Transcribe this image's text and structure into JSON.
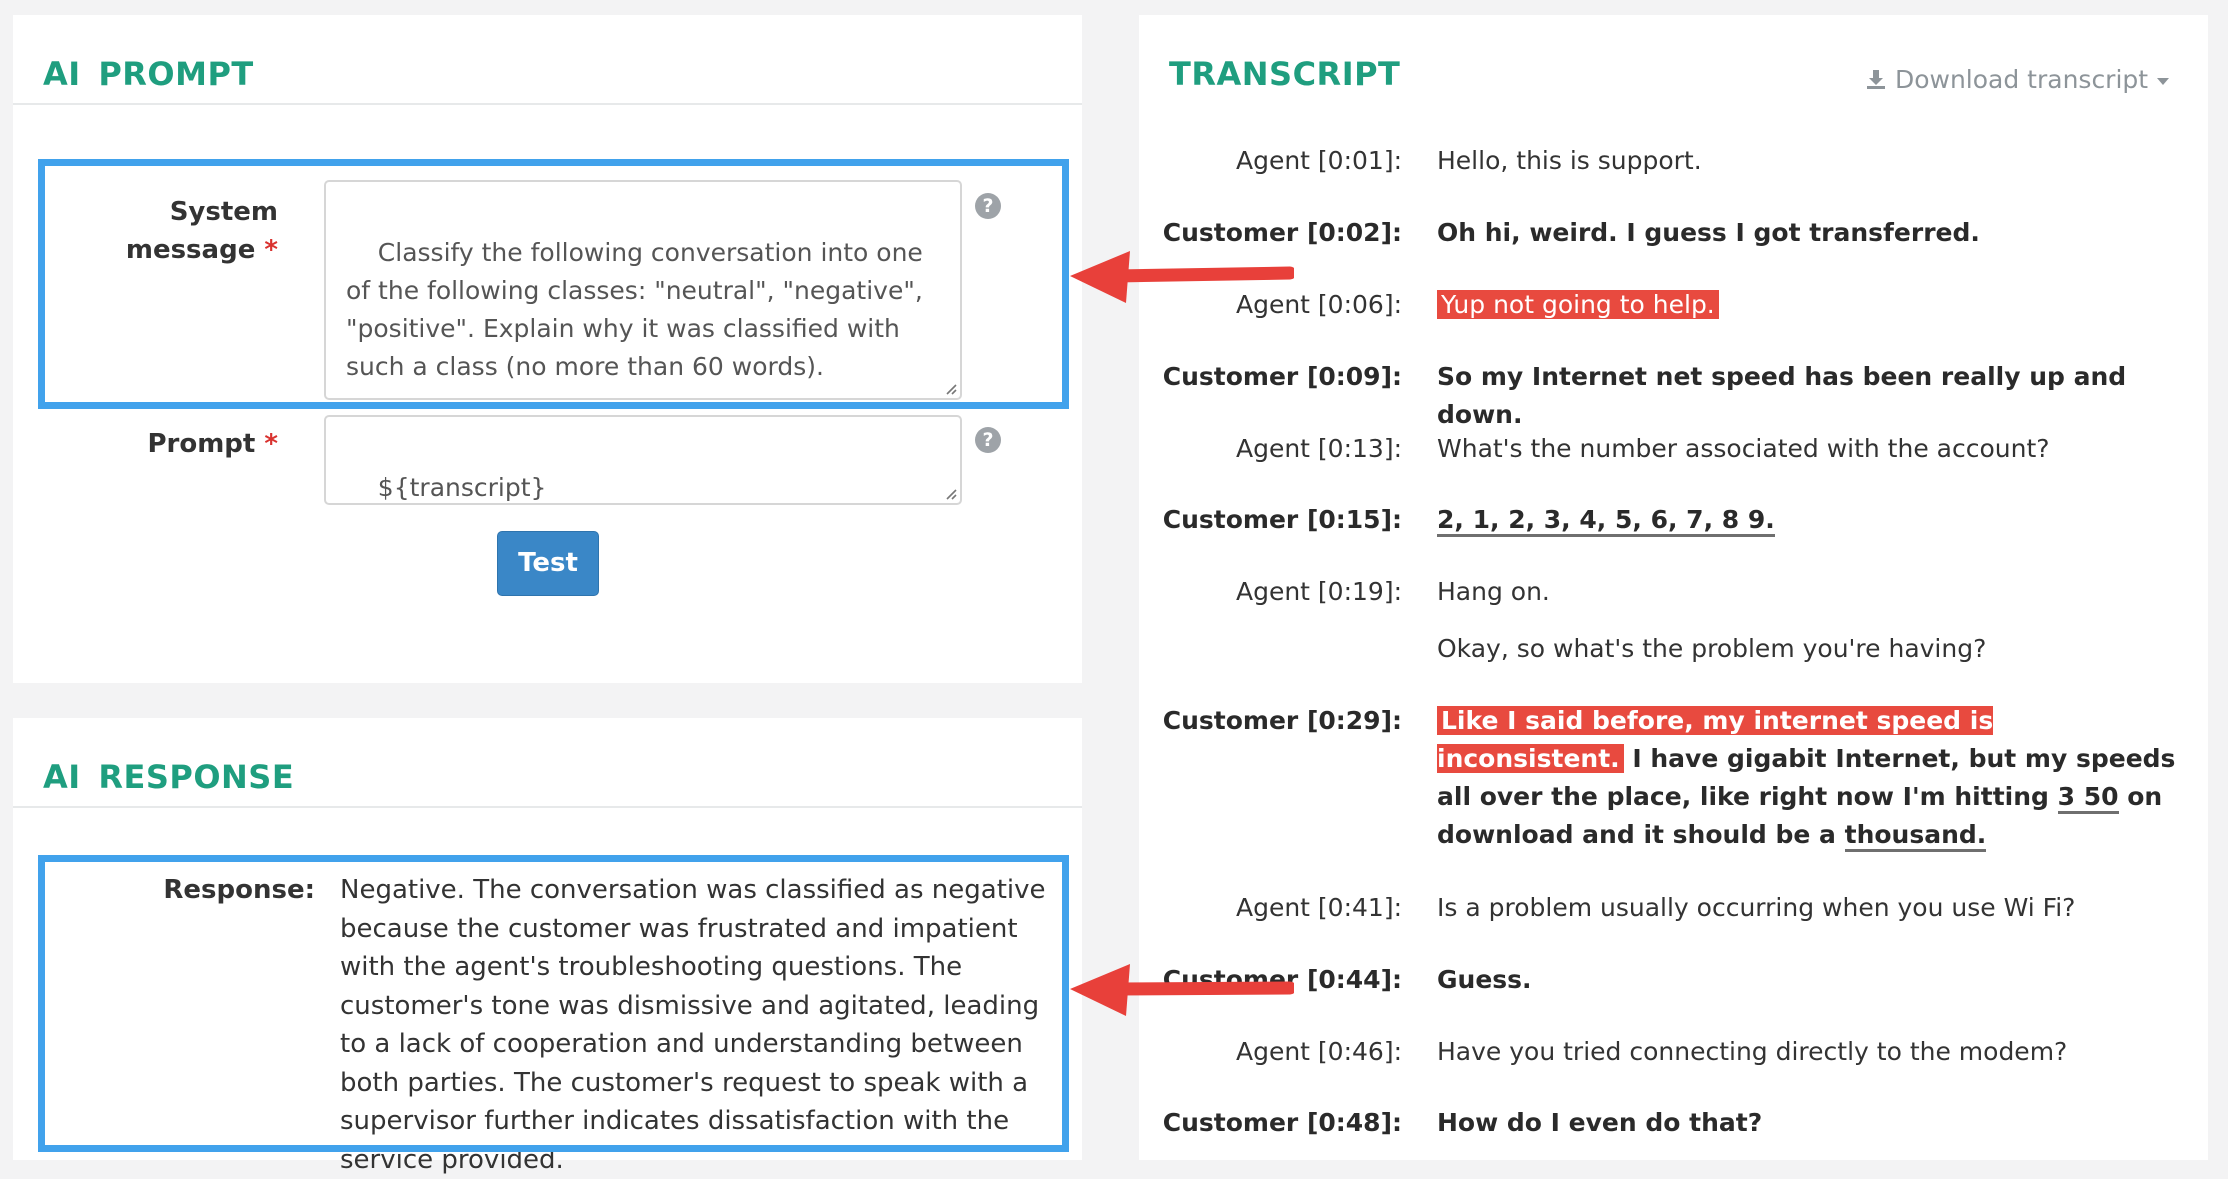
{
  "prompt_panel": {
    "title": "AI PROMPT",
    "system_label_1": "System",
    "system_label_2": "message",
    "required_mark": "*",
    "system_message": "Classify the following conversation into one of the following classes: \"neutral\", \"negative\", \"positive\". Explain why it was classified with such a class (no more than 60 words).",
    "prompt_label": "Prompt",
    "prompt_value": "${transcript}",
    "help_glyph": "?",
    "test_button": "Test"
  },
  "response_panel": {
    "title": "AI RESPONSE",
    "response_label": "Response:",
    "response_text": "Negative. The conversation was classified as negative because the customer was frustrated and impatient with the agent's troubleshooting questions. The customer's tone was dismissive and agitated, leading to a lack of cooperation and understanding between both parties. The customer's request to speak with a supervisor further indicates dissatisfaction with the service provided."
  },
  "transcript_panel": {
    "title": "TRANSCRIPT",
    "download_label": "Download transcript",
    "lines": [
      {
        "speaker": "Agent [0:01]:",
        "text": "Hello, this is support."
      },
      {
        "speaker": "Customer [0:02]:",
        "text": "Oh hi, weird. I guess I got transferred."
      },
      {
        "speaker": "Agent [0:06]:",
        "text": "Yup not going to help."
      },
      {
        "speaker": "Customer [0:09]:",
        "text": "So my Internet net speed has been really up and down."
      },
      {
        "speaker": "Agent [0:13]:",
        "text": "What's the number associated with the account?"
      },
      {
        "speaker": "Customer [0:15]:",
        "text": "2, 1, 2, 3, 4, 5, 6, 7, 8 9."
      },
      {
        "speaker": "Agent [0:19]:",
        "text": "Hang on."
      },
      {
        "speaker": "",
        "text": "Okay, so what's the problem you're having?"
      },
      {
        "speaker": "Customer [0:29]:",
        "text_highlight": "Like I said before, my internet speed is inconsistent.",
        "text_a": " I have gigabit Internet, but my speeds all over the place, like right now I'm hitting ",
        "text_ul1": "3 50",
        "text_b": " on download and it should be a ",
        "text_ul2": "thousand."
      },
      {
        "speaker": "Agent [0:41]:",
        "text": "Is a problem usually occurring when you use Wi Fi?"
      },
      {
        "speaker": "Customer [0:44]:",
        "text": "Guess."
      },
      {
        "speaker": "Agent [0:46]:",
        "text": "Have you tried connecting directly to the modem?"
      },
      {
        "speaker": "Customer [0:48]:",
        "text": "How do I even do that?"
      }
    ]
  },
  "colors": {
    "accent_title": "#1f9e7f",
    "frame": "#41a2ec",
    "arrow": "#e8403a",
    "highlight": "#e84a3f",
    "button": "#3a87c7"
  }
}
